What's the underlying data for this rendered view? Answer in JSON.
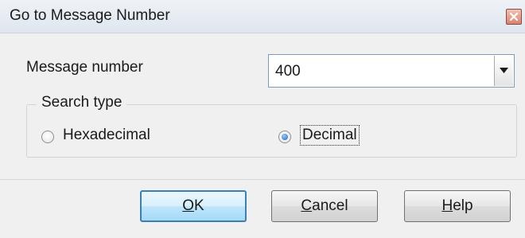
{
  "window": {
    "title": "Go to Message Number",
    "close_icon": "close-icon"
  },
  "form": {
    "message_number_label": "Message number",
    "message_number_value": "400",
    "dropdown_icon": "chevron-down-icon"
  },
  "search_type": {
    "legend": "Search type",
    "options": [
      {
        "label": "Hexadecimal",
        "selected": false
      },
      {
        "label": "Decimal",
        "selected": true
      }
    ]
  },
  "buttons": {
    "ok_mnemonic": "O",
    "ok_rest": "K",
    "cancel_mnemonic": "C",
    "cancel_rest": "ancel",
    "help_mnemonic": "H",
    "help_rest": "elp"
  },
  "colors": {
    "accent": "#3c7fb1",
    "dialog_bg": "#f0f0f0"
  }
}
